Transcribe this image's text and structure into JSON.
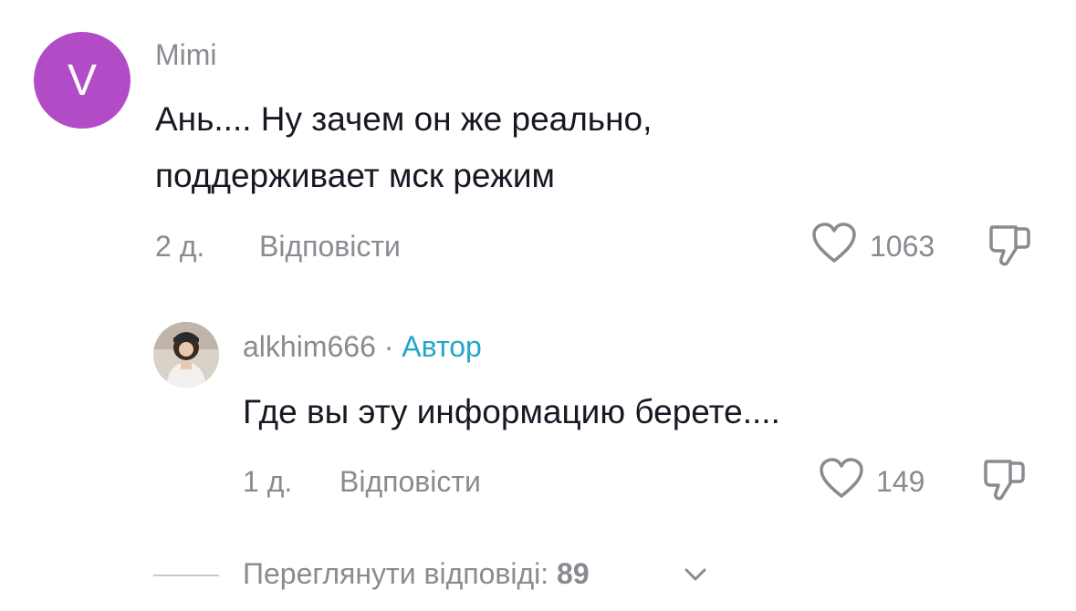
{
  "comment": {
    "avatar_letter": "V",
    "avatar_color": "#b14cc6",
    "username": "Mimi",
    "text_line1": "Ань.... Ну зачем он же реально,",
    "text_line2": "поддерживает мск режим",
    "time": "2 д.",
    "reply_label": "Відповісти",
    "likes": "1063",
    "like_icon": "heart-outline-icon",
    "dislike_icon": "thumbs-down-icon"
  },
  "reply": {
    "username": "alkhim666",
    "separator": "·",
    "author_badge": "Автор",
    "author_color": "#20a8c7",
    "text": "Где вы эту информацию берете....",
    "time": "1 д.",
    "reply_label": "Відповісти",
    "likes": "149"
  },
  "view_replies": {
    "label": "Переглянути відповіді:",
    "count": "89",
    "icon": "chevron-down-icon"
  }
}
